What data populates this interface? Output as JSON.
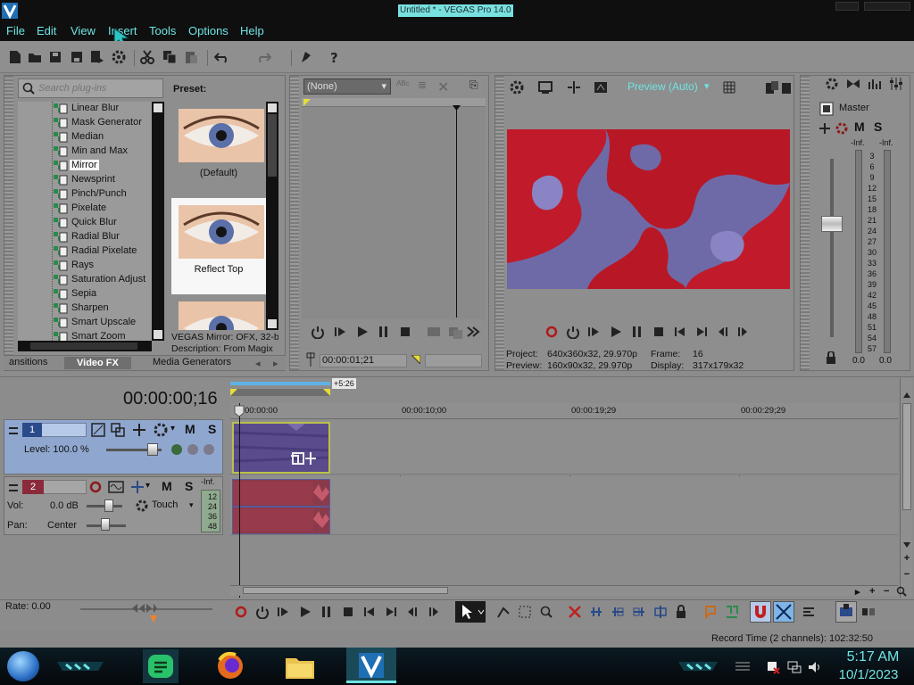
{
  "window": {
    "title": "Untitled * - VEGAS Pro 14.0"
  },
  "menu": [
    "File",
    "Edit",
    "View",
    "Insert",
    "Tools",
    "Options",
    "Help"
  ],
  "plugins": {
    "search_placeholder": "Search plug-ins",
    "items": [
      "Linear Blur",
      "Mask Generator",
      "Median",
      "Min and Max",
      "Mirror",
      "Newsprint",
      "Pinch/Punch",
      "Pixelate",
      "Quick Blur",
      "Radial Blur",
      "Radial Pixelate",
      "Rays",
      "Saturation Adjust",
      "Sepia",
      "Sharpen",
      "Smart Upscale",
      "Smart Zoom"
    ],
    "selected": "Mirror"
  },
  "presets": {
    "label": "Preset:",
    "items": [
      "(Default)",
      "Reflect Top"
    ],
    "selected": "Reflect Top"
  },
  "description": {
    "line1": "VEGAS Mirror: OFX, 32-b",
    "line2": "Description: From Magix"
  },
  "panel_tabs": [
    "ansitions",
    "Video FX",
    "Media Generators"
  ],
  "panel_tab_active": "Video FX",
  "trimmer": {
    "select_value": "(None)",
    "timecode": "00:00:01;21"
  },
  "preview": {
    "mode": "Preview (Auto)",
    "project": "Project:",
    "project_value": "640x360x32, 29.970p",
    "preview": "Preview:",
    "preview_value": "160x90x32, 29.970p",
    "frame": "Frame:",
    "frame_value": "16",
    "display": "Display:",
    "display_value": "317x179x32"
  },
  "master": {
    "label": "Master",
    "m": "M",
    "s": "S",
    "inf_left": "-Inf.",
    "inf_right": "-Inf.",
    "scale": [
      "3",
      "6",
      "9",
      "12",
      "15",
      "18",
      "21",
      "24",
      "27",
      "30",
      "33",
      "36",
      "39",
      "42",
      "45",
      "48",
      "51",
      "54",
      "57"
    ],
    "value_left": "0.0",
    "value_right": "0.0"
  },
  "timeline": {
    "timecode": "00:00:00;16",
    "loop_badge": "+5:26",
    "ruler": [
      "00:00:00",
      "00:00:10;00",
      "00:00:19;29",
      "00:00:29;29"
    ],
    "rate": "Rate: 0.00"
  },
  "track1": {
    "number": "1",
    "level_label": "Level: 100.0 %",
    "m": "M",
    "s": "S"
  },
  "track2": {
    "number": "2",
    "vol_label": "Vol:",
    "vol_value": "0.0 dB",
    "pan_label": "Pan:",
    "pan_value": "Center",
    "touch": "Touch",
    "m": "M",
    "s": "S",
    "meter_inf": "-Inf.",
    "meter_scale": [
      "12",
      "24",
      "36",
      "48"
    ]
  },
  "status": {
    "record_time": "Record Time (2 channels): 102:32:50"
  },
  "taskbar": {
    "time": "5:17 AM",
    "date": "10/1/2023"
  },
  "colors": {
    "accent": "#6fe3e3",
    "track1_header": "#8fa7cf",
    "video_clip": "#5a4c8c",
    "audio_clip": "#8a3a4a",
    "preview_red": "#c11a2a",
    "preview_blue": "#6e6aa8"
  }
}
